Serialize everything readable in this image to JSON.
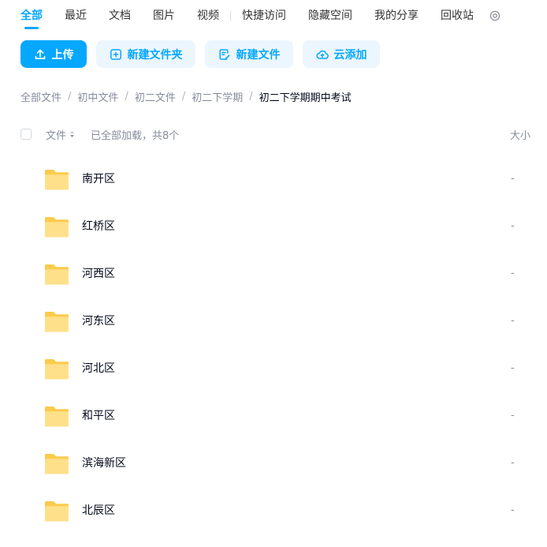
{
  "tabs": [
    {
      "label": "全部",
      "active": true
    },
    {
      "label": "最近",
      "active": false
    },
    {
      "label": "文档",
      "active": false
    },
    {
      "label": "图片",
      "active": false
    },
    {
      "label": "视频",
      "active": false
    },
    {
      "label": "快捷访问",
      "active": false
    },
    {
      "label": "隐藏空间",
      "active": false
    },
    {
      "label": "我的分享",
      "active": false
    },
    {
      "label": "回收站",
      "active": false
    }
  ],
  "toolbar": {
    "upload_label": "上传",
    "new_folder_label": "新建文件夹",
    "new_file_label": "新建文件",
    "cloud_add_label": "云添加"
  },
  "breadcrumb": {
    "items": [
      "全部文件",
      "初中文件",
      "初二文件",
      "初二下学期"
    ],
    "current": "初二下学期期中考试",
    "separator": "/"
  },
  "list_header": {
    "file_label": "文件",
    "status": "已全部加载，共8个",
    "size_label": "大小"
  },
  "files": [
    {
      "name": "南开区",
      "size": "-"
    },
    {
      "name": "红桥区",
      "size": "-"
    },
    {
      "name": "河西区",
      "size": "-"
    },
    {
      "name": "河东区",
      "size": "-"
    },
    {
      "name": "河北区",
      "size": "-"
    },
    {
      "name": "和平区",
      "size": "-"
    },
    {
      "name": "滨海新区",
      "size": "-"
    },
    {
      "name": "北辰区",
      "size": "-"
    }
  ],
  "colors": {
    "accent": "#06a7ff",
    "soft_button_bg": "#ecf6fe",
    "folder_back": "#fbcb4d",
    "folder_front": "#ffe08a",
    "muted_text": "#878c9c",
    "primary_text": "#03081a"
  },
  "icons": {
    "upload": "upload-icon",
    "new_folder": "new-folder-icon",
    "new_file": "new-file-icon",
    "cloud_add": "cloud-upload-icon",
    "settings": "settings-icon",
    "sort": "sort-icon",
    "folder": "folder-icon"
  }
}
